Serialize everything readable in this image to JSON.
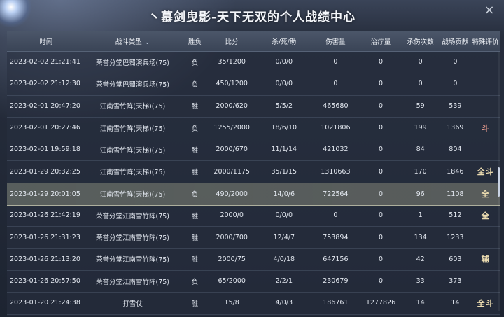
{
  "window": {
    "title": "丶慕剑曳影-天下无双的个人战绩中心",
    "close_symbol": "×"
  },
  "columns": [
    "时间",
    "战斗类型",
    "胜负",
    "比分",
    "杀/死/助",
    "伤害量",
    "治疗量",
    "承伤次数",
    "战场贡献",
    "特殊评价"
  ],
  "sort_symbol": "⌄",
  "rows": [
    {
      "time": "2023-02-02  21:21:41",
      "type": "荣誉分堂巴蜀演兵场(75)",
      "result": "负",
      "score": "35/1200",
      "kda": "0/0/0",
      "damage": "0",
      "heal": "0",
      "injured": "0",
      "contribution": "0",
      "eval": ""
    },
    {
      "time": "2023-02-02  21:12:30",
      "type": "荣誉分堂巴蜀演兵场(75)",
      "result": "负",
      "score": "450/1200",
      "kda": "0/0/0",
      "damage": "0",
      "heal": "0",
      "injured": "0",
      "contribution": "0",
      "eval": ""
    },
    {
      "time": "2023-02-01  20:47:20",
      "type": "江南雪竹阵(天梯)(75)",
      "result": "胜",
      "score": "2000/620",
      "kda": "5/5/2",
      "damage": "465680",
      "heal": "0",
      "injured": "59",
      "contribution": "539",
      "eval": ""
    },
    {
      "time": "2023-02-01  20:27:46",
      "type": "江南雪竹阵(天梯)(75)",
      "result": "负",
      "score": "1255/2000",
      "kda": "18/6/10",
      "damage": "1021806",
      "heal": "0",
      "injured": "199",
      "contribution": "1369",
      "eval": "斗"
    },
    {
      "time": "2023-02-01  19:59:18",
      "type": "江南雪竹阵(天梯)(75)",
      "result": "胜",
      "score": "2000/670",
      "kda": "11/1/14",
      "damage": "421032",
      "heal": "0",
      "injured": "84",
      "contribution": "804",
      "eval": ""
    },
    {
      "time": "2023-01-29  20:32:25",
      "type": "江南雪竹阵(天梯)(75)",
      "result": "胜",
      "score": "2000/1175",
      "kda": "35/1/15",
      "damage": "1310663",
      "heal": "0",
      "injured": "170",
      "contribution": "1846",
      "eval": "全斗"
    },
    {
      "time": "2023-01-29  20:01:05",
      "type": "江南雪竹阵(天梯)(75)",
      "result": "负",
      "score": "490/2000",
      "kda": "14/0/6",
      "damage": "722564",
      "heal": "0",
      "injured": "96",
      "contribution": "1108",
      "eval": "全"
    },
    {
      "time": "2023-01-26  21:42:19",
      "type": "荣誉分堂江南雪竹阵(75)",
      "result": "胜",
      "score": "2000/0",
      "kda": "0/0/0",
      "damage": "0",
      "heal": "0",
      "injured": "1",
      "contribution": "512",
      "eval": "全"
    },
    {
      "time": "2023-01-26  21:31:23",
      "type": "荣誉分堂江南雪竹阵(75)",
      "result": "胜",
      "score": "2000/700",
      "kda": "12/4/7",
      "damage": "753894",
      "heal": "0",
      "injured": "134",
      "contribution": "1233",
      "eval": ""
    },
    {
      "time": "2023-01-26  21:13:20",
      "type": "荣誉分堂江南雪竹阵(75)",
      "result": "胜",
      "score": "2000/75",
      "kda": "4/0/18",
      "damage": "647156",
      "heal": "0",
      "injured": "42",
      "contribution": "603",
      "eval": "辅"
    },
    {
      "time": "2023-01-26  20:57:50",
      "type": "荣誉分堂江南雪竹阵(75)",
      "result": "负",
      "score": "65/2000",
      "kda": "2/2/1",
      "damage": "230679",
      "heal": "0",
      "injured": "33",
      "contribution": "373",
      "eval": ""
    },
    {
      "time": "2023-01-20  21:24:38",
      "type": "打雪仗",
      "result": "胜",
      "score": "15/8",
      "kda": "4/0/3",
      "damage": "186761",
      "heal": "1277826",
      "injured": "14",
      "contribution": "14",
      "eval": "全斗"
    }
  ],
  "selected_row": 6,
  "scroll_position": 0.5
}
